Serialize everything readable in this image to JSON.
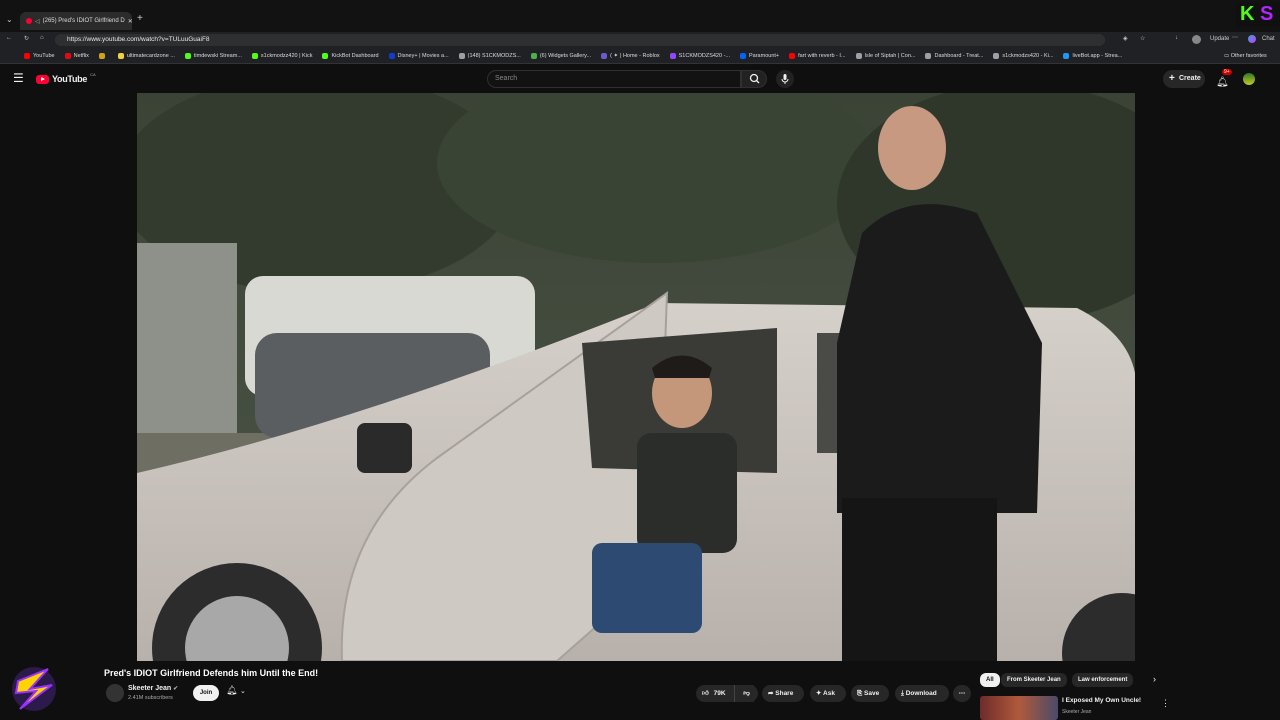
{
  "browser": {
    "tab_title": "(265) Pred's IDIOT Girlfriend D",
    "url": "https://www.youtube.com/watch?v=TULuuGuaiF8",
    "update_label": "Update",
    "chat_label": "Chat",
    "bookmarks": [
      {
        "label": "YouTube",
        "color": "#ff0000"
      },
      {
        "label": "Netflix",
        "color": "#e50914"
      },
      {
        "label": "",
        "color": "#d4a017"
      },
      {
        "label": "ultimatecardzone ...",
        "color": "#f4d03f"
      },
      {
        "label": "timdewski Stream...",
        "color": "#53fc18"
      },
      {
        "label": "s1ckmodzz420 | Kick",
        "color": "#53fc18"
      },
      {
        "label": "KickBot Dashboard",
        "color": "#53fc18"
      },
      {
        "label": "Disney+ | Movies a...",
        "color": "#113ccf"
      },
      {
        "label": "(148) S1CKMODZS...",
        "color": "#9aa0a6"
      },
      {
        "label": "(6) Widgets Gallery...",
        "color": "#4caf50"
      },
      {
        "label": "( ✦ ) Home - Roblox",
        "color": "#6a5acd"
      },
      {
        "label": "S1CKMODZS420 -...",
        "color": "#9147ff"
      },
      {
        "label": "Paramount+",
        "color": "#0064ff"
      },
      {
        "label": "fart with reverb - I...",
        "color": "#ff0000"
      },
      {
        "label": "Isle of Siptah | Con...",
        "color": "#9aa0a6"
      },
      {
        "label": "Dashboard - Treat...",
        "color": "#9aa0a6"
      },
      {
        "label": "s1ckmodzs420 - Ki...",
        "color": "#9aa0a6"
      },
      {
        "label": "liveBot.app - Strea...",
        "color": "#2196f3"
      }
    ],
    "other_favorites": "Other favorites"
  },
  "yt": {
    "logo_text": "YouTube",
    "country": "CA",
    "search_placeholder": "Search",
    "create_label": "Create",
    "notif_count": "9+"
  },
  "video": {
    "title": "Pred's IDIOT Girlfriend Defends him Until the End!",
    "channel": "Skeeter Jean",
    "subscribers": "2.41M subscribers",
    "join_label": "Join",
    "like_count": "79K",
    "share_label": "Share",
    "ask_label": "Ask",
    "save_label": "Save",
    "download_label": "Download"
  },
  "chips": [
    "All",
    "From Skeeter Jean",
    "Law enforcement"
  ],
  "recommended": {
    "title": "I Exposed My Own Uncle!",
    "channel": "Skeeter Jean"
  },
  "overlay": {
    "badge_k": "K",
    "badge_s": "S",
    "badge_k_color": "#53fc18",
    "badge_s_color": "#b026ff"
  }
}
